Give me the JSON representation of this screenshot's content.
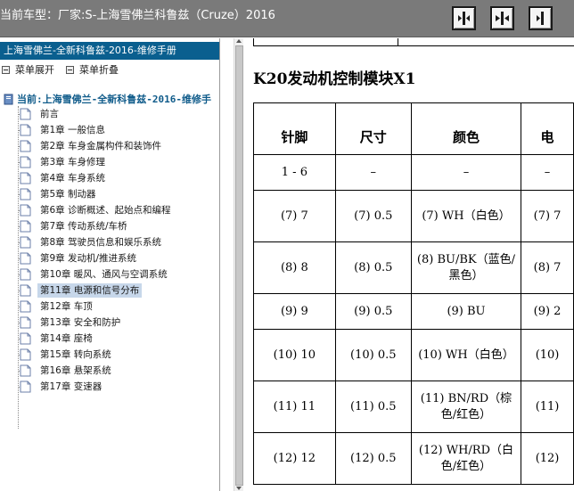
{
  "window": {
    "title": "当前车型：厂家:S-上海雪佛兰科鲁兹（Cruze）2016"
  },
  "toolbar": {
    "buttons": [
      {
        "name": "nav-prev",
        "icon": "arrow-left-right-icon"
      },
      {
        "name": "nav-toggle",
        "icon": "arrows-inward-icon"
      },
      {
        "name": "nav-next",
        "icon": "arrow-right-icon"
      }
    ]
  },
  "sidebar": {
    "manual_title": "上海雪佛兰-全新科鲁兹-2016-维修手册",
    "expand_label": "菜单展开",
    "collapse_label": "菜单折叠",
    "tree_root": "当前:上海雪佛兰-全新科鲁兹-2016-维修手",
    "items": [
      {
        "label": "前言"
      },
      {
        "label": "第1章  一般信息"
      },
      {
        "label": "第2章  车身金属构件和装饰件"
      },
      {
        "label": "第3章  车身修理"
      },
      {
        "label": "第4章  车身系统"
      },
      {
        "label": "第5章  制动器"
      },
      {
        "label": "第6章  诊断概述、起始点和编程"
      },
      {
        "label": "第7章  传动系统/车桥"
      },
      {
        "label": "第8章  驾驶员信息和娱乐系统"
      },
      {
        "label": "第9章  发动机/推进系统"
      },
      {
        "label": "第10章  暖风、通风与空调系统"
      },
      {
        "label": "第11章  电源和信号分布"
      },
      {
        "label": "第12章  车顶"
      },
      {
        "label": "第13章  安全和防护"
      },
      {
        "label": "第14章  座椅"
      },
      {
        "label": "第15章  转向系统"
      },
      {
        "label": "第16章  悬架系统"
      },
      {
        "label": "第17章  变速器"
      }
    ],
    "selected_index": 11
  },
  "content": {
    "section_title": "K20发动机控制模块X1",
    "table": {
      "headers": [
        "针脚",
        "尺寸",
        "颜色",
        "电"
      ],
      "rows": [
        {
          "pin": "1 - 6",
          "size": "–",
          "color": "–",
          "circuit": "–"
        },
        {
          "pin": "(7) 7",
          "size": "(7) 0.5",
          "color": "(7) WH（白色）",
          "circuit": "(7) 7"
        },
        {
          "pin": "(8) 8",
          "size": "(8) 0.5",
          "color": "(8) BU/BK（蓝色/黑色）",
          "circuit": "(8) 7"
        },
        {
          "pin": "(9) 9",
          "size": "(9) 0.5",
          "color": "(9) BU",
          "circuit": "(9) 2"
        },
        {
          "pin": "(10) 10",
          "size": "(10) 0.5",
          "color": "(10) WH（白色）",
          "circuit": "(10)"
        },
        {
          "pin": "(11) 11",
          "size": "(11) 0.5",
          "color": "(11) BN/RD（棕色/红色）",
          "circuit": "(11)"
        },
        {
          "pin": "(12) 12",
          "size": "(12) 0.5",
          "color": "(12) WH/RD（白色/红色）",
          "circuit": "(12)"
        }
      ]
    }
  },
  "colors": {
    "topbar_bg": "#7a7a7a",
    "header_bg": "#0a5f8f",
    "selected_bg": "#c7d7ea",
    "root_text": "#0f5b8a"
  }
}
